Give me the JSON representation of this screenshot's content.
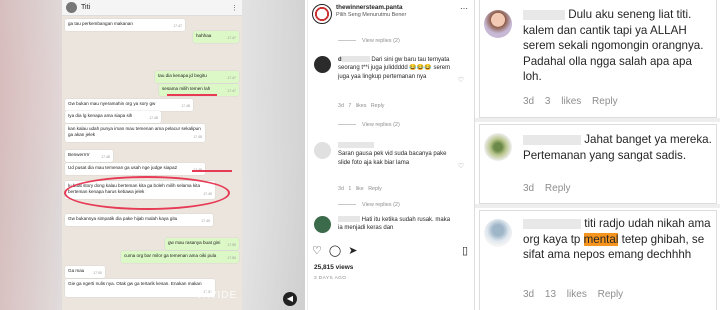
{
  "chat": {
    "contact": "Titi",
    "messages": [
      {
        "dir": "in",
        "text": "ga tau perkembangan makanan",
        "time": "17.47"
      },
      {
        "dir": "out",
        "text": "hahhaa",
        "time": "17.47"
      },
      {
        "dir": "out",
        "text": "tau dia kenapa jd begitu",
        "time": "17.47"
      },
      {
        "dir": "out",
        "text": "sesama milih temen lah",
        "time": "17.47"
      },
      {
        "dir": "in",
        "text": "Gw bukan mau nyeramahin org ya sory gw",
        "time": "17.48"
      },
      {
        "dir": "in",
        "text": "Iya dia lg kenapa ama siapa sih",
        "time": "17.48"
      },
      {
        "dir": "in",
        "text": "kan kalau udah punya iman mau temenan ama pelacur sekalipun ga akan jelek",
        "time": "17.48"
      },
      {
        "dir": "in",
        "text": "Benwerrrrr",
        "time": "17.48"
      },
      {
        "dir": "in",
        "text": "Ud pusat dia mau temenan ga usah nge judge siapa2",
        "time": "17.48"
      },
      {
        "dir": "in",
        "text": "lu buat story dong kalau berteman kita ga boleh milih selama kita berteman kenapa harus kebawa jelek",
        "time": "17.49"
      },
      {
        "dir": "in",
        "text": "Gw bukannya simpatik dia pake hijab malah kaya gitu",
        "time": "17.49"
      },
      {
        "dir": "out",
        "text": "gw mau rasanya buat gini",
        "time": "17.50"
      },
      {
        "dir": "out",
        "text": "cuma org bar milor ga temenan ama oiki pula",
        "time": "17.50"
      },
      {
        "dir": "in",
        "text": "Ga mau",
        "time": "17.50"
      },
      {
        "dir": "in",
        "text": "Gie ga ngerti nulis nya. Otak gw ga tertarik kesan. Enakan makan",
        "time": "17.51"
      }
    ],
    "watermark": "VAVIDE",
    "pip_icon": "mute-icon"
  },
  "ig": {
    "username": "thewinnersteam.panta",
    "subtitle": "Pilih Seng Menurutmu Bener",
    "view_replies": "View replies (2)",
    "comments": [
      {
        "name": "d",
        "text": "Dari sini gw baru tau ternyata seorang t**i juga juliddddd 😂😂😂 serem juga yaa lingkup pertemanan nya",
        "meta": "3d 7 likes Reply",
        "avatar": "#2b2b2b"
      },
      {
        "name": "",
        "text": "Saran gausa pek vid suda bacanya pake slide foto aja kak biar lama",
        "meta": "3d 1 like Reply",
        "avatar": "#d9d9d9"
      },
      {
        "name": "",
        "text": "Hati itu ketika sudah rusak. maka ia menjadi keras dan",
        "meta": "",
        "avatar": "#3b6b4a"
      }
    ],
    "views": "25,815 views",
    "days": "3 DAYS AGO"
  },
  "comments": [
    {
      "text": "Dulu aku seneng liat titi. kalem dan cantik tapi ya ALLAH serem sekali ngomongin orangnya. Padahal olla ngga salah apa apa loh.",
      "time": "3d",
      "likes": "3 likes",
      "reply": "Reply"
    },
    {
      "text": "Jahat banget ya mereka. Pertemanan yang sangat sadis.",
      "time": "3d",
      "likes": "",
      "reply": "Reply"
    },
    {
      "text_a": "titi radjo udah nikah ama org kaya tp",
      "hl": "mental",
      "text_b": "tetep ghibah, se sifat ama nepos emang dechhhh",
      "time": "3d",
      "likes": "13 likes",
      "reply": "Reply"
    }
  ]
}
